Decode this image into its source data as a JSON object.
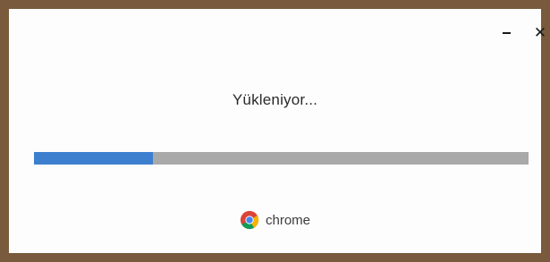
{
  "window": {
    "minimize_icon": "minimize-icon",
    "close_icon": "close-icon",
    "close_glyph": "✕"
  },
  "main": {
    "status_text": "Yükleniyor...",
    "progress_fraction": 0.24
  },
  "brand": {
    "name": "chrome",
    "icon": "chrome-logo-icon"
  },
  "colors": {
    "frame_border": "#7a5a3c",
    "progress_fill": "#3d7fcf",
    "progress_track": "#a9a9a9"
  }
}
